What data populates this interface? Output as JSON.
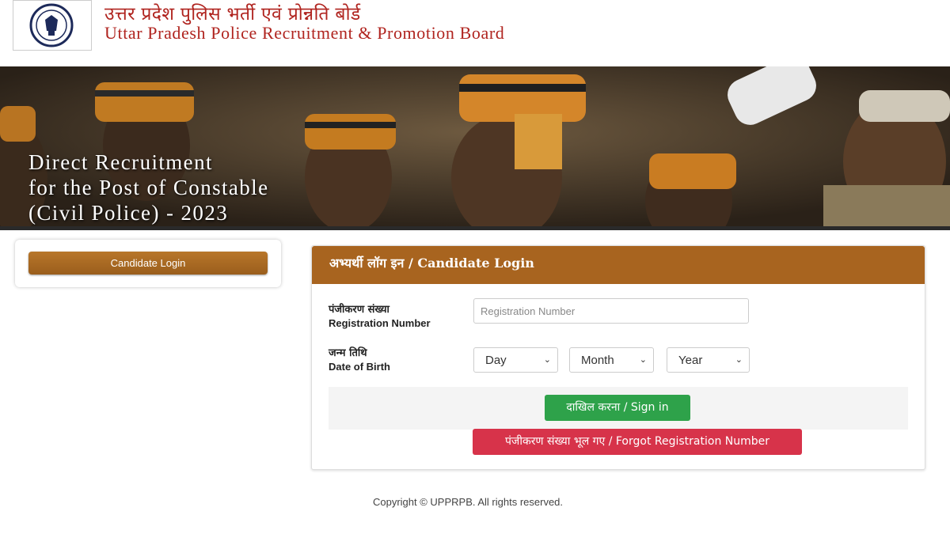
{
  "header": {
    "title_hindi": "उत्तर प्रदेश पुलिस भर्ती एवं प्रोन्नति बोर्ड",
    "title_english": "Uttar Pradesh Police Recruitment & Promotion Board",
    "logo_icon": "up-police-emblem"
  },
  "banner": {
    "line1": "Direct Recruitment",
    "line2": "for the Post of Constable",
    "line3": "(Civil Police) - 2023"
  },
  "sidebar": {
    "candidate_login_label": "Candidate Login"
  },
  "form": {
    "heading": "अभ्यर्थी लॉग इन / Candidate Login",
    "registration_label_hi": "पंजीकरण संख्या",
    "registration_label_en": "Registration Number",
    "registration_placeholder": "Registration Number",
    "dob_label_hi": "जन्म तिथि",
    "dob_label_en": "Date of Birth",
    "day_value": "Day",
    "month_value": "Month",
    "year_value": "Year",
    "signin_label": "दाखिल करना / Sign in",
    "forgot_label": "पंजीकरण संख्या भूल गए / Forgot Registration Number"
  },
  "footer": {
    "copyright": "Copyright © UPPRPB. All rights reserved."
  },
  "colors": {
    "brand_red": "#b0241f",
    "header_brown": "#a8641f",
    "signin_green": "#2ea24a",
    "forgot_red": "#d7334a"
  }
}
